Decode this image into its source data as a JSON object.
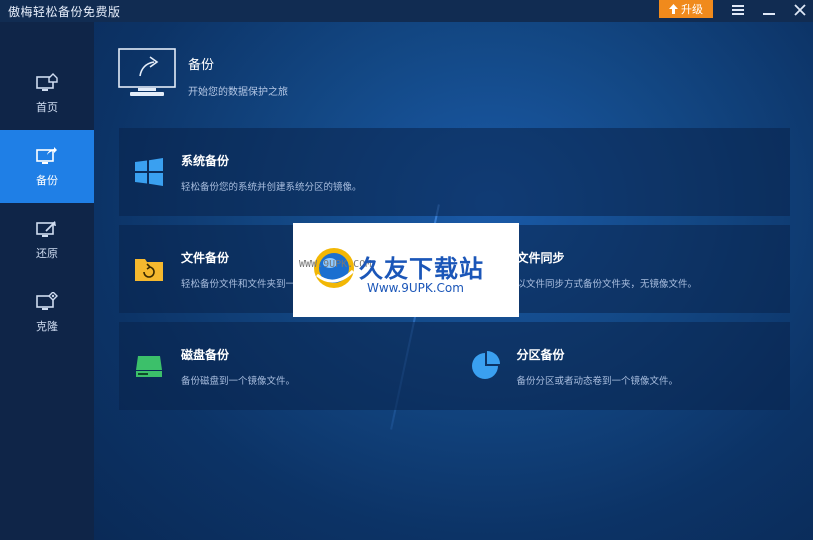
{
  "window": {
    "title": "傲梅轻松备份免费版",
    "upgrade_label": "升级",
    "menu_icon": "menu-icon",
    "minimize_icon": "minimize-icon",
    "close_icon": "close-icon"
  },
  "sidebar": {
    "items": [
      {
        "label": "首页",
        "icon": "home-icon"
      },
      {
        "label": "备份",
        "icon": "backup-icon",
        "active": true
      },
      {
        "label": "还原",
        "icon": "restore-icon"
      },
      {
        "label": "克隆",
        "icon": "clone-icon"
      }
    ]
  },
  "header": {
    "title": "备份",
    "subtitle": "开始您的数据保护之旅"
  },
  "cards": {
    "system": {
      "title": "系统备份",
      "desc": "轻松备份您的系统并创建系统分区的镜像。"
    },
    "file": {
      "title": "文件备份",
      "desc": "轻松备份文件和文件夹到一个镜像文件。"
    },
    "sync": {
      "title": "文件同步",
      "desc": "以文件同步方式备份文件夹，无镜像文件。"
    },
    "disk": {
      "title": "磁盘备份",
      "desc": "备份磁盘到一个镜像文件。"
    },
    "partition": {
      "title": "分区备份",
      "desc": "备份分区或者动态卷到一个镜像文件。"
    }
  },
  "watermark": {
    "url_top": "WWW.9UPK.COM",
    "brand": "久友下载站",
    "url": "Www.9UPK.Com"
  },
  "colors": {
    "accent": "#1f7fe6",
    "upgrade": "#f08a1c",
    "windows_icon": "#3aa0f0",
    "folder_icon": "#f5b82e",
    "disk_icon": "#3cc06a",
    "pie_icon": "#3aa0f0"
  }
}
